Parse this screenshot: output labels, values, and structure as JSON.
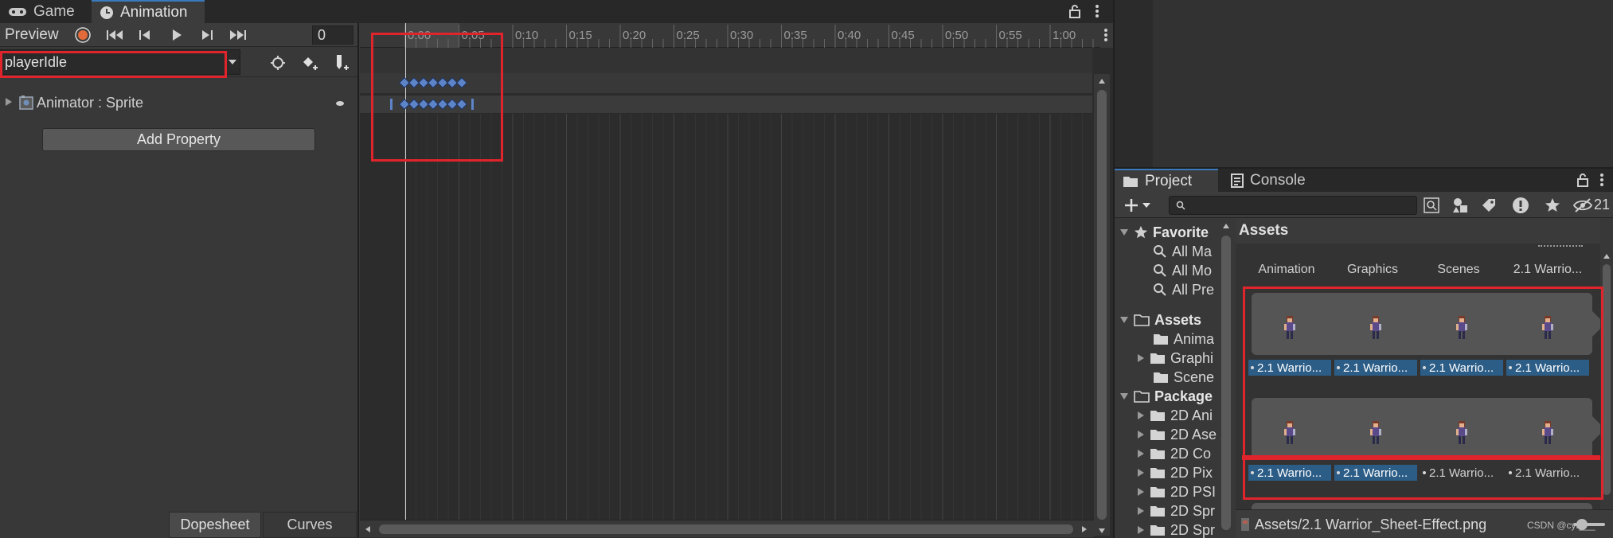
{
  "animation": {
    "tabs": [
      {
        "label": "Game",
        "icon": "gamepad-icon"
      },
      {
        "label": "Animation",
        "icon": "clock-icon"
      }
    ],
    "toolbar": {
      "preview_label": "Preview",
      "frame_value": "0"
    },
    "clip": {
      "name": "playerIdle"
    },
    "property": {
      "label": "Animator : Sprite"
    },
    "add_property_label": "Add Property",
    "bottom_tabs": [
      {
        "label": "Dopesheet"
      },
      {
        "label": "Curves"
      }
    ],
    "ruler_labels": [
      "0:00",
      "0:05",
      "0:10",
      "0:15",
      "0:20",
      "0:25",
      "0:30",
      "0:35",
      "0:40",
      "0:45",
      "0:50",
      "0:55",
      "1:00"
    ]
  },
  "project": {
    "tabs": [
      {
        "label": "Project",
        "icon": "folder-icon"
      },
      {
        "label": "Console",
        "icon": "console-icon"
      }
    ],
    "hidden_count": "21",
    "tree": {
      "favorites_label": "Favorite",
      "favorites": [
        "All Ma",
        "All Mo",
        "All Pre"
      ],
      "assets_label": "Assets",
      "assets": [
        "Anima",
        "Graphi",
        "Scene"
      ],
      "packages_label": "Package",
      "packages": [
        "2D Ani",
        "2D Ase",
        "2D Co",
        "2D Pix",
        "2D PSI",
        "2D Spr",
        "2D Spr"
      ]
    },
    "breadcrumb": "Assets",
    "folders": [
      "Animation",
      "Graphics",
      "Scenes",
      "2.1 Warrio..."
    ],
    "asset_rows": [
      {
        "labels": [
          "2.1 Warrio...",
          "2.1 Warrio...",
          "2.1 Warrio...",
          "2.1 Warrio..."
        ]
      },
      {
        "labels": [
          "2.1 Warrio...",
          "2.1 Warrio...",
          "2.1 Warrio...",
          "2.1 Warrio..."
        ]
      }
    ],
    "footer_path": "Assets/2.1 Warrior_Sheet-Effect.png",
    "watermark": "CSDN @cyr___"
  },
  "colors": {
    "accent": "#3a79bb",
    "highlight": "#e0242c",
    "keyframe": "#5d84c9",
    "selected_label": "#2c5d87",
    "record": "#e26a3b"
  }
}
